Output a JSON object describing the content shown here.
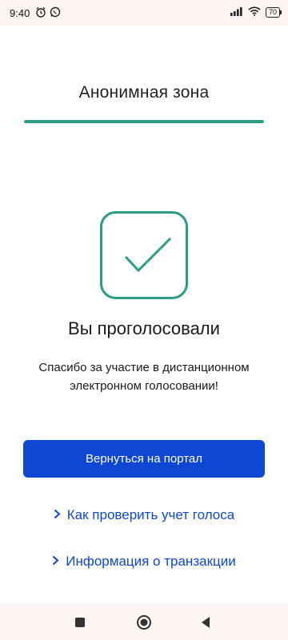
{
  "status_bar": {
    "time": "9:40",
    "left_icons": [
      "alarm-icon",
      "whatsapp-icon"
    ],
    "right_icons": [
      "signal-icon",
      "wifi-icon"
    ],
    "battery": "70"
  },
  "header": {
    "title": "Анонимная зона"
  },
  "progress": {
    "value": 1.0,
    "color": "#2a9d84"
  },
  "result": {
    "icon": "check-icon",
    "title": "Вы проголосовали",
    "message": "Спасибо за участие в дистанционном электронном голосовании!"
  },
  "actions": {
    "primary_button": "Вернуться на портал",
    "links": [
      "Как проверить учет голоса",
      "Информация о транзакции"
    ]
  },
  "colors": {
    "accent": "#2a9d84",
    "primary": "#0d47d4"
  },
  "nav_bar": {
    "buttons": [
      "recents-icon",
      "home-icon",
      "back-icon"
    ]
  }
}
